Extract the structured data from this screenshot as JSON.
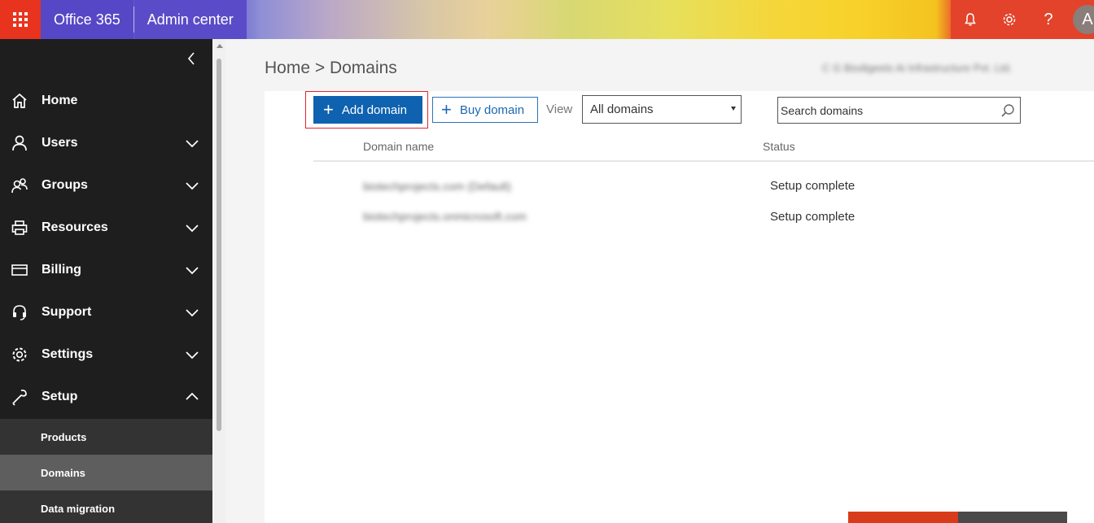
{
  "topbar": {
    "brand": "Office 365",
    "app_name": "Admin center",
    "avatar_initial": "A",
    "icons": [
      "app-launcher-icon",
      "bell-icon",
      "gear-icon",
      "help-icon"
    ],
    "help_glyph": "?"
  },
  "sidebar": {
    "items": [
      {
        "label": "Home",
        "icon": "home-icon"
      },
      {
        "label": "Users",
        "icon": "user-icon"
      },
      {
        "label": "Groups",
        "icon": "groups-icon"
      },
      {
        "label": "Resources",
        "icon": "printer-icon"
      },
      {
        "label": "Billing",
        "icon": "credit-card-icon"
      },
      {
        "label": "Support",
        "icon": "headset-icon"
      },
      {
        "label": "Settings",
        "icon": "gear-icon"
      },
      {
        "label": "Setup",
        "icon": "wrench-icon"
      }
    ],
    "setup_subitems": [
      {
        "label": "Products"
      },
      {
        "label": "Domains"
      },
      {
        "label": "Data migration"
      }
    ]
  },
  "main": {
    "breadcrumb": "Home > Domains",
    "tenant_name": "C G Biodigeets Ai Infrastructure Pvt. Ltd.",
    "toolbar": {
      "add_label": "Add domain",
      "buy_label": "Buy domain",
      "view_label": "View",
      "view_selected": "All domains",
      "search_placeholder": "Search domains"
    },
    "table": {
      "columns": [
        "Domain name",
        "Status"
      ],
      "rows": [
        {
          "domain": "biotechprojects.com (Default)",
          "status": "Setup complete"
        },
        {
          "domain": "biotechprojects.onmicrosoft.com",
          "status": "Setup complete"
        }
      ]
    }
  },
  "colors": {
    "accent_blue": "#0f62b0",
    "highlight_red": "#e0262b",
    "sidebar_bg": "#1e1e1e",
    "topbar_red": "#e2432a"
  }
}
